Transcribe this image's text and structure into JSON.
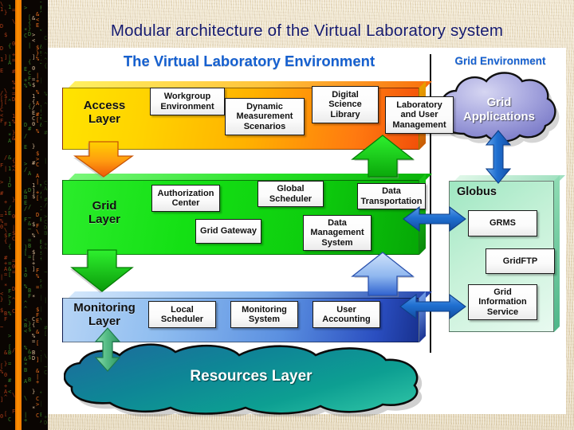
{
  "title": "Modular architecture of the Virtual Laboratory system",
  "headers": {
    "left": "The Virtual Laboratory Environment",
    "right": "Grid Environment"
  },
  "layers": [
    {
      "id": "access",
      "name": "Access\nLayer",
      "name_line1": "Access",
      "name_line2": "Layer",
      "color": "#ffd400",
      "boxes": [
        {
          "label": "Workgroup\nEnvironment",
          "l1": "Workgroup",
          "l2": "Environment"
        },
        {
          "label": "Dynamic\nMeasurement\nScenarios",
          "l1": "Dynamic",
          "l2": "Measurement",
          "l3": "Scenarios"
        },
        {
          "label": "Digital\nScience\nLibrary",
          "l1": "Digital",
          "l2": "Science",
          "l3": "Library"
        },
        {
          "label": "Laboratory\nand User\nManagement",
          "l1": "Laboratory",
          "l2": "and User",
          "l3": "Management"
        }
      ]
    },
    {
      "id": "grid",
      "name": "Grid\nLayer",
      "name_line1": "Grid",
      "name_line2": "Layer",
      "color": "#14e014",
      "boxes": [
        {
          "label": "Authorization\nCenter",
          "l1": "Authorization",
          "l2": "Center"
        },
        {
          "label": "Global\nScheduler",
          "l1": "Global",
          "l2": "Scheduler"
        },
        {
          "label": "Data\nTransportation",
          "l1": "Data",
          "l2": "Transportation"
        },
        {
          "label": "Grid Gateway",
          "l1": "Grid Gateway"
        },
        {
          "label": "Data\nManagement\nSystem",
          "l1": "Data",
          "l2": "Management",
          "l3": "System"
        }
      ]
    },
    {
      "id": "monitoring",
      "name": "Monitoring\nLayer",
      "name_line1": "Monitoring",
      "name_line2": "Layer",
      "color": "#5a8fe0",
      "boxes": [
        {
          "label": "Local\nScheduler",
          "l1": "Local",
          "l2": "Scheduler"
        },
        {
          "label": "Monitoring\nSystem",
          "l1": "Monitoring",
          "l2": "System"
        },
        {
          "label": "User\nAccounting",
          "l1": "User",
          "l2": "Accounting"
        }
      ]
    }
  ],
  "globus": {
    "name": "Globus",
    "color": "#9fe7c2",
    "boxes": [
      {
        "label": "GRMS",
        "l1": "GRMS"
      },
      {
        "label": "GridFTP",
        "l1": "GridFTP"
      },
      {
        "label": "Grid\nInformation\nService",
        "l1": "Grid",
        "l2": "Information",
        "l3": "Service"
      }
    ]
  },
  "clouds": [
    {
      "id": "grid-applications",
      "l1": "Grid",
      "l2": "Applications",
      "color": "#8f8fd6"
    },
    {
      "id": "resources-layer",
      "l1": "Resources Layer",
      "color": "#0e8f92"
    }
  ],
  "arrows": [
    {
      "name": "access-to-grid-arrow",
      "direction": "down",
      "color": "#f58410"
    },
    {
      "name": "grid-to-access-arrow",
      "direction": "up",
      "color": "#1fd21f"
    },
    {
      "name": "grid-to-monitoring-arrow",
      "direction": "down",
      "color": "#1fd21f"
    },
    {
      "name": "monitoring-to-grid-arrow",
      "direction": "up",
      "color": "#7aa8e8"
    },
    {
      "name": "monitoring-resources-arrow",
      "direction": "both-vertical",
      "color": "#4fb87a"
    },
    {
      "name": "grid-globus-arrow",
      "direction": "both-horizontal",
      "color": "#1f6fd0"
    },
    {
      "name": "monitoring-globus-arrow",
      "direction": "both-horizontal",
      "color": "#1f6fd0"
    },
    {
      "name": "globus-applications-arrow",
      "direction": "both-vertical",
      "color": "#1f6fd0"
    }
  ],
  "theme": {
    "title_color": "#151a6e",
    "header_color": "#1560d0",
    "canvas_bg": "#ffffff",
    "page_bg": "#e8dcc0",
    "accent_stripe": "#ff9000"
  }
}
